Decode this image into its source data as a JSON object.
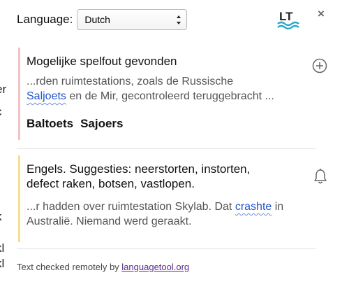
{
  "background": {
    "letters": [
      "er",
      "c",
      "k",
      "kl",
      "kl"
    ]
  },
  "header": {
    "language_label": "Language:",
    "selected_language": "Dutch",
    "logo_text": "LT",
    "close_symbol": "×"
  },
  "matches": [
    {
      "title": "Mogelijke spelfout gevonden",
      "context_line1": "...rden ruimtestations, zoals de Russische",
      "error_word": "Saljoets",
      "context_after": " en de Mir, gecontroleerd teruggebracht ...",
      "suggestions": [
        "Baltoets",
        "Sajoers"
      ],
      "action_icon": "plus-circle-icon",
      "accent_color": "#f3c4c6"
    },
    {
      "title_line1": "Engels. Suggesties: neerstorten, instorten,",
      "title_line2": "defect raken, botsen, vastlopen.",
      "context_before": "...r hadden over ruimtestation Skylab. Dat ",
      "error_word": "crashte",
      "context_after": " in",
      "context_line2": "Australië. Niemand werd geraakt.",
      "action_icon": "bell-icon",
      "accent_color": "#f6df94"
    }
  ],
  "footer": {
    "text": "Text checked remotely by ",
    "link_text": "languagetool.org"
  }
}
